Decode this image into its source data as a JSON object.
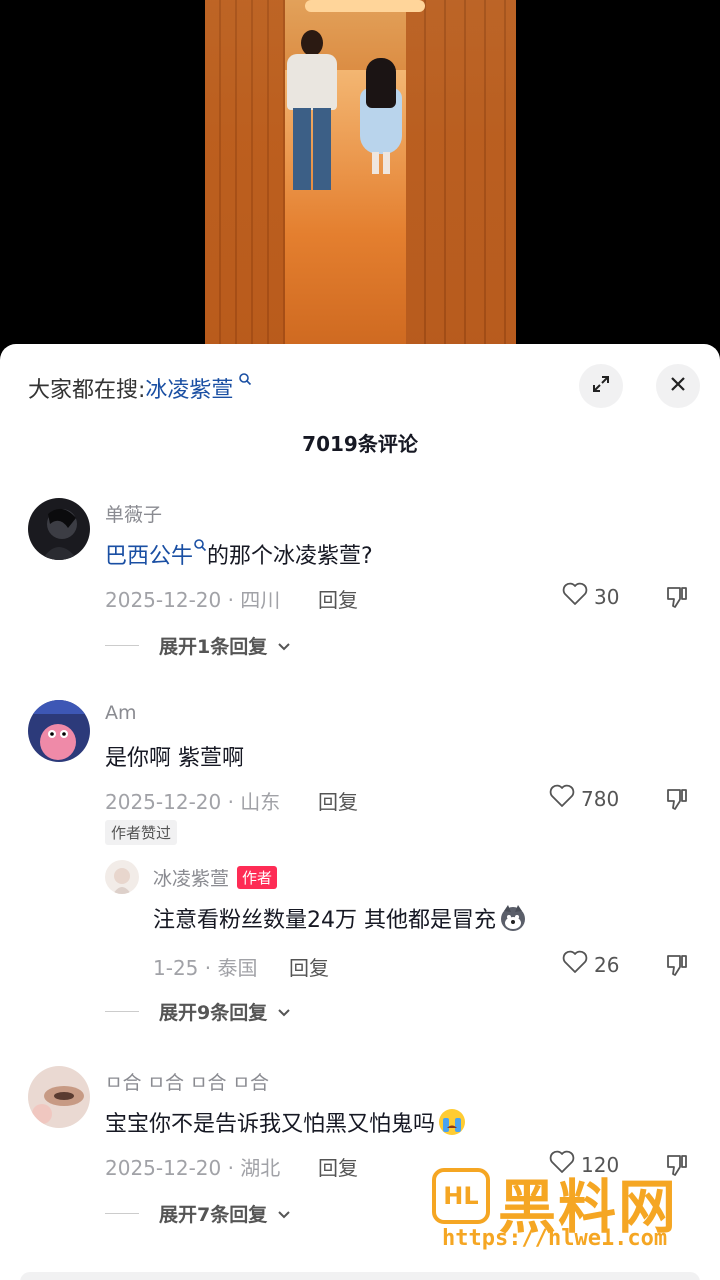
{
  "header": {
    "search_prefix": "大家都在搜:",
    "search_keyword": "冰凌紫萱",
    "comment_count": "7019条评论"
  },
  "icons": {
    "expand": "expand-icon",
    "close": "close-icon",
    "search": "search-icon",
    "heart": "heart-icon",
    "dislike": "dislike-icon",
    "chevron": "chevron-down-icon"
  },
  "colors": {
    "link": "#1a4fa3",
    "author_tag": "#fe2c55",
    "watermark": "#f5a623"
  },
  "comments": [
    {
      "user": "单薇子",
      "text_keyword": "巴西公牛",
      "text_rest": "的那个冰凌紫萱?",
      "meta": "2025-12-20 · 四川",
      "reply_label": "回复",
      "likes": "30",
      "expand_label": "展开1条回复"
    },
    {
      "user": "Am",
      "text": "是你啊 紫萱啊",
      "meta": "2025-12-20 · 山东",
      "reply_label": "回复",
      "likes": "780",
      "author_liked": "作者赞过",
      "reply": {
        "user": "冰凌紫萱",
        "author_tag": "作者",
        "text": "注意看粉丝数量24万 其他都是冒充",
        "meta": "1-25 · 泰国",
        "reply_label": "回复",
        "likes": "26"
      },
      "expand_label": "展开9条回复"
    },
    {
      "user": "ㅁ合 ㅁ合 ㅁ合 ㅁ合",
      "text": "宝宝你不是告诉我又怕黑又怕鬼吗",
      "meta": "2025-12-20 · 湖北",
      "reply_label": "回复",
      "likes": "120",
      "expand_label": "展开7条回复"
    }
  ],
  "watermark": {
    "logo": "HL",
    "text": "黑料网",
    "url": "https://hlwe1.com"
  }
}
